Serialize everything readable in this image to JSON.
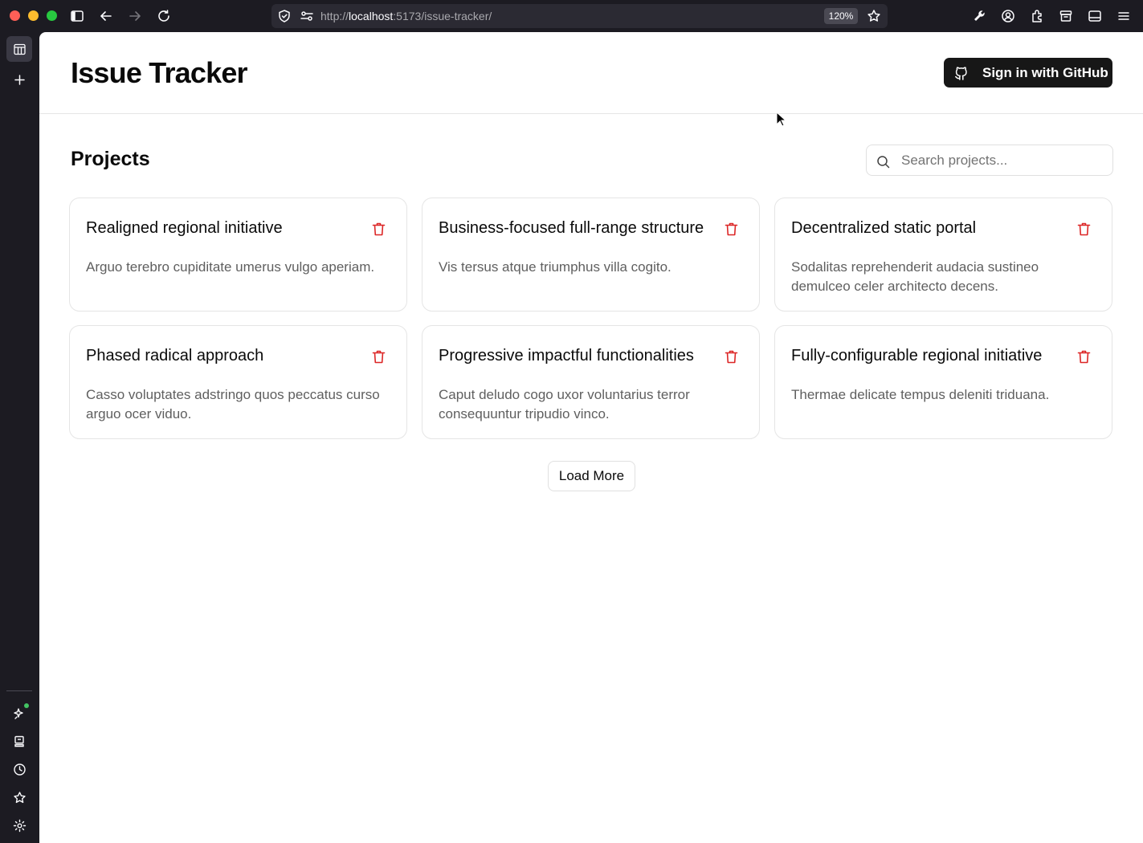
{
  "browser": {
    "url_prefix": "http://",
    "url_host": "localhost",
    "url_rest": ":5173/issue-tracker/",
    "zoom": "120%"
  },
  "header": {
    "title": "Issue Tracker",
    "signin_label": "Sign in with GitHub"
  },
  "projects": {
    "title": "Projects",
    "search_placeholder": "Search projects...",
    "load_more_label": "Load More",
    "items": [
      {
        "title": "Realigned regional initiative",
        "description": "Arguo terebro cupiditate umerus vulgo aperiam."
      },
      {
        "title": "Business-focused full-range structure",
        "description": "Vis tersus atque triumphus villa cogito."
      },
      {
        "title": "Decentralized static portal",
        "description": "Sodalitas reprehenderit audacia sustineo demulceo celer architecto decens."
      },
      {
        "title": "Phased radical approach",
        "description": "Casso voluptates adstringo quos peccatus curso arguo ocer viduo."
      },
      {
        "title": "Progressive impactful functionalities",
        "description": "Caput deludo cogo uxor voluntarius terror consequuntur tripudio vinco."
      },
      {
        "title": "Fully-configurable regional initiative",
        "description": "Thermae delicate tempus deleniti triduana."
      }
    ]
  },
  "colors": {
    "delete_icon": "#dc2626",
    "primary_button": "#171717",
    "browser_chrome": "#1c1b22"
  },
  "icons": {
    "delete": "trash-icon",
    "signin": "github-icon",
    "search": "search-icon"
  }
}
